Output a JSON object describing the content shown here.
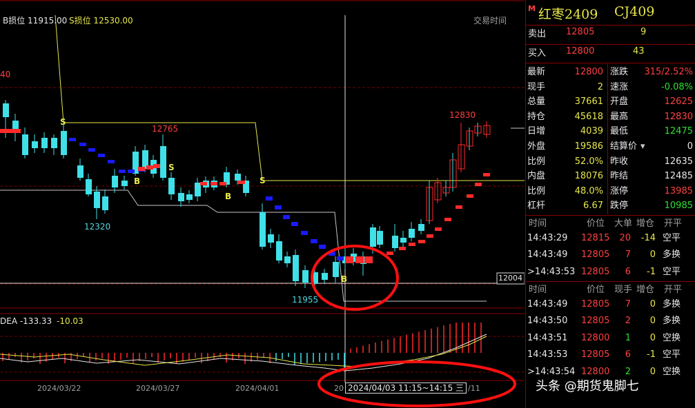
{
  "chart_header": {
    "b_stop": "B损位 11915.00",
    "s_stop": "S损位 12530.00",
    "trade_time_label": "交易时间",
    "left_cut_value": "40"
  },
  "annotations": {
    "high_label": "12830",
    "mid_high_label": "12765",
    "low_label_1": "12320",
    "low_label_2": "11955",
    "crosshair_price": "12004",
    "crosshair_time": "2024/04/03 11:15~14:15 三",
    "signal_s": "S",
    "signal_b": "B"
  },
  "macd": {
    "dea_label": "DEA -133.33",
    "dea_value": "-10.03"
  },
  "date_axis": [
    "2024/03/22",
    "2024/03/27",
    "2024/04/01",
    "20",
    "/11"
  ],
  "quote": {
    "marker": "M",
    "name": "红枣2409",
    "code": "CJ409",
    "sell_label": "卖出",
    "sell_price": "12805",
    "sell_qty": "9",
    "buy_label": "买入",
    "buy_price": "12800",
    "buy_qty": "43",
    "rows": [
      {
        "l1": "最新",
        "v1": "12800",
        "c1": "#ff4040",
        "l2": "涨跌",
        "v2": "315/2.52%",
        "c2": "#ff4040"
      },
      {
        "l1": "现手",
        "v1": "2",
        "c1": "#e8e84a",
        "l2": "速涨",
        "v2": "-0.08%",
        "c2": "#30e030"
      },
      {
        "l1": "总量",
        "v1": "37661",
        "c1": "#e8e84a",
        "l2": "开盘",
        "v2": "12625",
        "c2": "#ff4040"
      },
      {
        "l1": "持仓",
        "v1": "45618",
        "c1": "#e8e84a",
        "l2": "最高",
        "v2": "12830",
        "c2": "#ff4040"
      },
      {
        "l1": "日增",
        "v1": "4039",
        "c1": "#e8e84a",
        "l2": "最低",
        "v2": "12475",
        "c2": "#30e030"
      },
      {
        "l1": "外盘",
        "v1": "19586",
        "c1": "#e8e84a",
        "l2": "结算价",
        "v2": "0",
        "c2": "#e8e8e8"
      },
      {
        "l1": "比例",
        "v1": "52.0%",
        "c1": "#e8e84a",
        "l2": "昨收",
        "v2": "12635",
        "c2": "#e8e8e8"
      },
      {
        "l1": "内盘",
        "v1": "18076",
        "c1": "#e8e84a",
        "l2": "昨结",
        "v2": "12485",
        "c2": "#e8e8e8"
      },
      {
        "l1": "比例",
        "v1": "48.0%",
        "c1": "#e8e84a",
        "l2": "涨停",
        "v2": "13985",
        "c2": "#ff4040"
      },
      {
        "l1": "杠杆",
        "v1": "6.67",
        "c1": "#e8e84a",
        "l2": "跌停",
        "v2": "10985",
        "c2": "#30e030"
      }
    ],
    "table1": {
      "headers": [
        "时间",
        "价位",
        "大单",
        "增仓",
        "开平"
      ],
      "rows": [
        {
          "t": "14:43:29",
          "p": "12815",
          "q": "20",
          "d": "-14",
          "k": "空平",
          "qc": "#ff4040",
          "dc": "#e8e84a"
        },
        {
          "t": "14:43:49",
          "p": "12805",
          "q": "7",
          "d": "0",
          "k": "多换",
          "qc": "#ff4040",
          "dc": "#e8e84a"
        },
        {
          "t": ">14:43:53",
          "p": "12805",
          "q": "6",
          "d": "-1",
          "k": "空平",
          "qc": "#ff4040",
          "dc": "#e8e84a"
        }
      ]
    },
    "table2": {
      "headers": [
        "时间",
        "价位",
        "现手",
        "增仓",
        "开平"
      ],
      "rows": [
        {
          "t": "14:43:49",
          "p": "12805",
          "q": "7",
          "d": "0",
          "k": "多换",
          "qc": "#ff4040",
          "dc": "#e8e84a"
        },
        {
          "t": "14:43:50",
          "p": "12805",
          "q": "2",
          "d": "0",
          "k": "多换",
          "qc": "#ff4040",
          "dc": "#e8e84a"
        },
        {
          "t": "14:43:51",
          "p": "12800",
          "q": "1",
          "d": "0",
          "k": "空换",
          "qc": "#30e030",
          "dc": "#e8e84a"
        },
        {
          "t": "14:43:53",
          "p": "12805",
          "q": "6",
          "d": "-1",
          "k": "空平",
          "qc": "#ff4040",
          "dc": "#e8e84a"
        },
        {
          "t": ">14:43:54",
          "p": "12800",
          "q": "2",
          "d": "0",
          "k": "空换",
          "qc": "#30e030",
          "dc": "#e8e84a"
        }
      ]
    }
  },
  "watermark": "头条 @期货鬼脚七",
  "colors": {
    "up": "#ff2a2a",
    "down": "#40e0e8",
    "blue": "#1a1aff",
    "panel_border": "#8a0000"
  }
}
